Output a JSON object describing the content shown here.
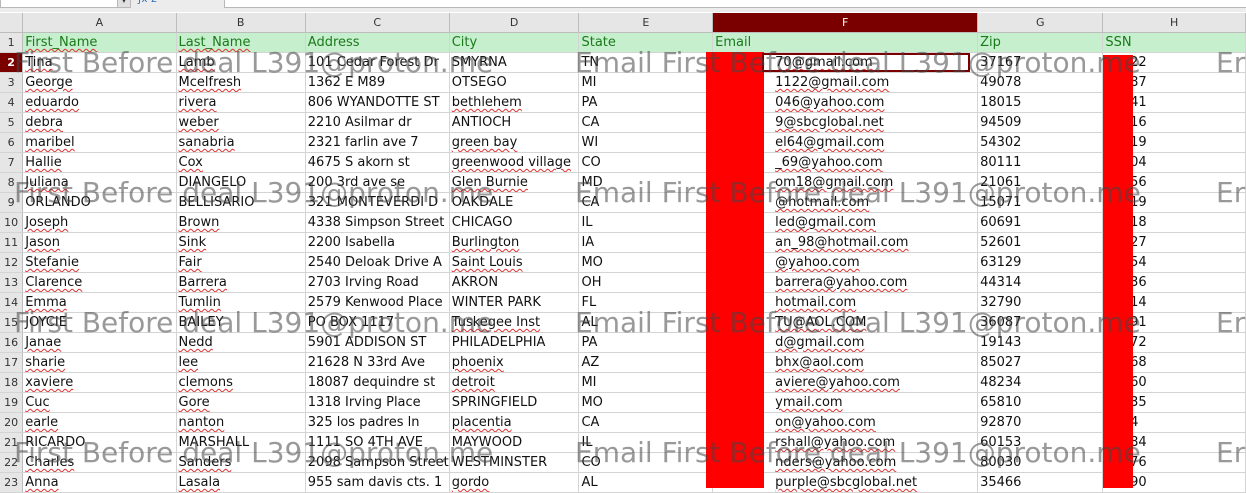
{
  "toolbar": {
    "namebox_value": "",
    "formula_value": "",
    "icons": [
      "chevron-down-icon",
      "function-wizard-icon",
      "sum-icon"
    ]
  },
  "columns": [
    "A",
    "B",
    "C",
    "D",
    "E",
    "F",
    "G",
    "H"
  ],
  "selected_column": "F",
  "selected_row": "2",
  "header": {
    "row_num": "1",
    "cells": [
      "First_Name",
      "Last_Name",
      "Address",
      "City",
      "State",
      "Email",
      "Zip",
      "SSN"
    ]
  },
  "rows": [
    {
      "n": "2",
      "cells": [
        "Tina",
        "Lamb",
        "101 Cedar Forest Dr",
        "SMYRNA",
        "TN",
        "70@gmail.com",
        "37167",
        "35622"
      ]
    },
    {
      "n": "3",
      "cells": [
        "George",
        "Mcelfresh",
        "1362 E M89",
        "OTSEGO",
        "MI",
        "1122@gmail.com",
        "49078",
        "00987"
      ]
    },
    {
      "n": "4",
      "cells": [
        "eduardo",
        "rivera",
        "806 WYANDOTTE ST",
        "bethlehem",
        "PA",
        "046@yahoo.com",
        "18015",
        "65041"
      ]
    },
    {
      "n": "5",
      "cells": [
        "debra",
        "weber",
        "2210 Asilmar dr",
        "ANTIOCH",
        "CA",
        "9@sbcglobal.net",
        "94509",
        "13516"
      ]
    },
    {
      "n": "6",
      "cells": [
        "maribel",
        "sanabria",
        "2321 farlin ave  7",
        "green bay",
        "WI",
        "el64@gmail.com",
        "54302",
        "72419"
      ]
    },
    {
      "n": "7",
      "cells": [
        "Hallie",
        "Cox",
        "4675 S akorn st",
        "greenwood village",
        "CO",
        "_69@yahoo.com",
        "80111",
        "44204"
      ]
    },
    {
      "n": "8",
      "cells": [
        "Juliana",
        "DIANGELO",
        "200 3rd ave se",
        "Glen Burnie",
        "MD",
        "om18@gmail.com",
        "21061",
        "86156"
      ]
    },
    {
      "n": "9",
      "cells": [
        "ORLANDO",
        "BELLISARIO",
        "321 MONTEVERDI D",
        "OAKDALE",
        "CA",
        "@hotmail.com",
        "15071",
        "46019"
      ]
    },
    {
      "n": "10",
      "cells": [
        "Joseph",
        "Brown",
        "4338 Simpson Street",
        "CHICAGO",
        "IL",
        "led@gmail.com",
        "60691",
        "26818"
      ]
    },
    {
      "n": "11",
      "cells": [
        "Jason",
        "Sink",
        "2200 Isabella",
        "Burlington",
        "IA",
        "an_98@hotmail.com",
        "52601",
        "13327"
      ]
    },
    {
      "n": "12",
      "cells": [
        "Stefanie",
        "Fair",
        "2540 Deloak Drive A",
        "Saint Louis",
        "MO",
        "@yahoo.com",
        "63129",
        "63554"
      ]
    },
    {
      "n": "13",
      "cells": [
        "Clarence",
        "Barrera",
        "2703 Irving Road",
        "AKRON",
        "OH",
        "barrera@yahoo.com",
        "44314",
        "48936"
      ]
    },
    {
      "n": "14",
      "cells": [
        "Emma",
        "Tumlin",
        "2579 Kenwood Place",
        "WINTER PARK",
        "FL",
        "hotmail.com",
        "32790",
        "52014"
      ]
    },
    {
      "n": "15",
      "cells": [
        "JOYCIE",
        "BAILEY",
        "PO BOX 1117",
        "Tuskegee Inst",
        "AL",
        "TU@AOL.COM",
        "36087",
        "43591"
      ]
    },
    {
      "n": "16",
      "cells": [
        "Janae",
        "Nedd",
        "5901 ADDISON ST",
        "PHILADELPHIA",
        "PA",
        "d@gmail.com",
        "19143",
        "47172"
      ]
    },
    {
      "n": "17",
      "cells": [
        "sharie",
        "lee",
        "21628 N 33rd Ave",
        "phoenix",
        "AZ",
        "bhx@aol.com",
        "85027",
        "52768"
      ]
    },
    {
      "n": "18",
      "cells": [
        "xaviere",
        "clemons",
        "18087 dequindre st",
        "detroit",
        "MI",
        "aviere@yahoo.com",
        "48234",
        "20260"
      ]
    },
    {
      "n": "19",
      "cells": [
        "Cuc",
        "Gore",
        "1318 Irving Place",
        "SPRINGFIELD",
        "MO",
        "ymail.com",
        "65810",
        "44735"
      ]
    },
    {
      "n": "20",
      "cells": [
        "earle",
        "nanton",
        "325 los padres ln",
        "placentia",
        "CA",
        "on@yahoo.com",
        "92870",
        "2834"
      ]
    },
    {
      "n": "21",
      "cells": [
        "RICARDO",
        "MARSHALL",
        "1111 SO 4TH AVE",
        "MAYWOOD",
        "IL",
        "rshall@yahoo.com",
        "60153",
        "66284"
      ]
    },
    {
      "n": "22",
      "cells": [
        "Charles",
        "Sanders",
        "2098 Sampson Street",
        "WESTMINSTER",
        "CO",
        "nders@yahoo.com",
        "80030",
        "61176"
      ]
    },
    {
      "n": "23",
      "cells": [
        "Anna",
        "Lasala",
        "955 sam davis cts. 1",
        "gordo",
        "AL",
        "purple@sbcglobal.net",
        "35466",
        "71090"
      ]
    }
  ],
  "watermark": {
    "text_a": "First Before deal L391@proton.me",
    "text_b": "Email First Before deal L391@proton.me",
    "text_c": "Er"
  },
  "colors": {
    "header_fill": "#c6efce",
    "header_text": "#1a7a1a",
    "selected": "#7a0000",
    "redaction": "#ff0000"
  }
}
